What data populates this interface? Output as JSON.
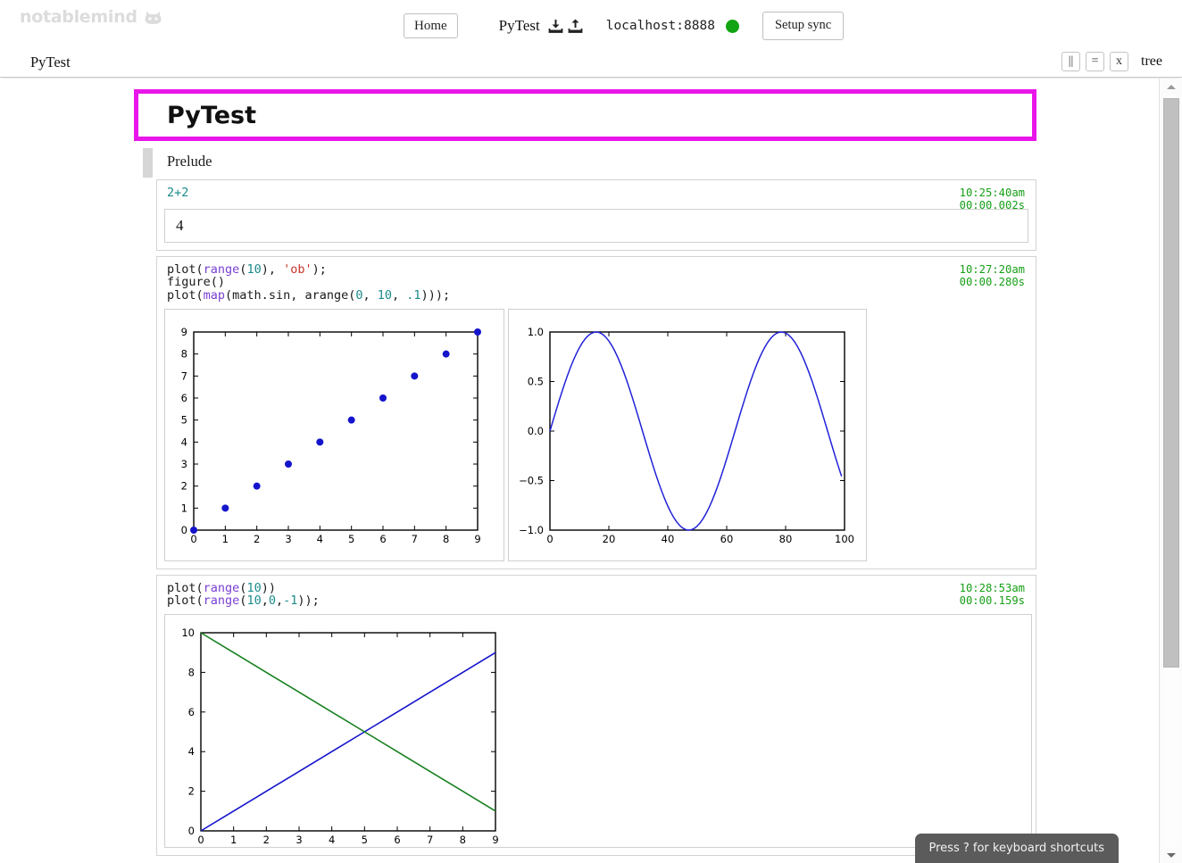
{
  "app": {
    "logo_text": "notablemind",
    "logo_icon": "cat-face-icon"
  },
  "header": {
    "home_label": "Home",
    "document_name": "PyTest",
    "download_icon": "download-icon",
    "upload_icon": "upload-icon",
    "hostname": "localhost:8888",
    "status": "connected",
    "status_color": "#13a413",
    "setup_sync_label": "Setup sync"
  },
  "breadcrumb": {
    "path": "PyTest",
    "tools": [
      {
        "name": "split-view-button",
        "label": "||"
      },
      {
        "name": "equals-button",
        "label": "="
      },
      {
        "name": "close-button",
        "label": "x"
      }
    ],
    "tree_label": "tree"
  },
  "document": {
    "title": "PyTest",
    "title_border_color": "#e916e9",
    "section_label": "Prelude"
  },
  "cells": [
    {
      "id": "cell-1",
      "code_lines": [
        [
          {
            "t": "2+2",
            "c": "exprline"
          }
        ]
      ],
      "timestamp": "10:25:40am",
      "duration": "00:00.002s",
      "result": "4",
      "figures": []
    },
    {
      "id": "cell-2",
      "code_lines": [
        [
          {
            "t": "plot",
            "c": "fn"
          },
          {
            "t": "(",
            "c": "punct"
          },
          {
            "t": "range",
            "c": "kw"
          },
          {
            "t": "(",
            "c": "punct"
          },
          {
            "t": "10",
            "c": "num"
          },
          {
            "t": "), ",
            "c": "punct"
          },
          {
            "t": "'ob'",
            "c": "str"
          },
          {
            "t": ");",
            "c": "punct"
          }
        ],
        [
          {
            "t": "figure",
            "c": "fn"
          },
          {
            "t": "()",
            "c": "punct"
          }
        ],
        [
          {
            "t": "plot",
            "c": "fn"
          },
          {
            "t": "(",
            "c": "punct"
          },
          {
            "t": "map",
            "c": "kw"
          },
          {
            "t": "(math.sin, arange(",
            "c": "punct"
          },
          {
            "t": "0",
            "c": "num"
          },
          {
            "t": ", ",
            "c": "punct"
          },
          {
            "t": "10",
            "c": "num"
          },
          {
            "t": ", ",
            "c": "punct"
          },
          {
            "t": ".1",
            "c": "num"
          },
          {
            "t": ")));",
            "c": "punct"
          }
        ]
      ],
      "timestamp": "10:27:20am",
      "duration": "00:00.280s",
      "result": null,
      "figures": [
        "figure-scatter",
        "figure-sine"
      ]
    },
    {
      "id": "cell-3",
      "code_lines": [
        [
          {
            "t": "plot",
            "c": "fn"
          },
          {
            "t": "(",
            "c": "punct"
          },
          {
            "t": "range",
            "c": "kw"
          },
          {
            "t": "(",
            "c": "punct"
          },
          {
            "t": "10",
            "c": "num"
          },
          {
            "t": "))",
            "c": "punct"
          }
        ],
        [
          {
            "t": "plot",
            "c": "fn"
          },
          {
            "t": "(",
            "c": "punct"
          },
          {
            "t": "range",
            "c": "kw"
          },
          {
            "t": "(",
            "c": "punct"
          },
          {
            "t": "10",
            "c": "num"
          },
          {
            "t": ",",
            "c": "punct"
          },
          {
            "t": "0",
            "c": "num"
          },
          {
            "t": ",",
            "c": "punct"
          },
          {
            "t": "-1",
            "c": "num"
          },
          {
            "t": "));",
            "c": "punct"
          }
        ]
      ],
      "timestamp": "10:28:53am",
      "duration": "00:00.159s",
      "result": null,
      "figures": [
        "figure-cross"
      ]
    }
  ],
  "chart_data": [
    {
      "id": "figure-scatter",
      "type": "scatter",
      "title": "",
      "xlabel": "",
      "ylabel": "",
      "xlim": [
        0,
        9
      ],
      "ylim": [
        0,
        9
      ],
      "xticks": [
        0,
        1,
        2,
        3,
        4,
        5,
        6,
        7,
        8,
        9
      ],
      "yticks": [
        0,
        1,
        2,
        3,
        4,
        5,
        6,
        7,
        8,
        9
      ],
      "grid": false,
      "legend": "none",
      "series": [
        {
          "name": "range(10)",
          "marker": "o",
          "color": "#1414cc",
          "x": [
            0,
            1,
            2,
            3,
            4,
            5,
            6,
            7,
            8,
            9
          ],
          "y": [
            0,
            1,
            2,
            3,
            4,
            5,
            6,
            7,
            8,
            9
          ]
        }
      ]
    },
    {
      "id": "figure-sine",
      "type": "line",
      "title": "",
      "xlabel": "",
      "ylabel": "",
      "xlim": [
        0,
        100
      ],
      "ylim": [
        -1.0,
        1.0
      ],
      "xticks": [
        0,
        20,
        40,
        60,
        80,
        100
      ],
      "yticks": [
        -1.0,
        -0.5,
        0.0,
        0.5,
        1.0
      ],
      "ytick_labels": [
        "−1.0",
        "−0.5",
        "0.0",
        "0.5",
        "1.0"
      ],
      "grid": false,
      "legend": "none",
      "series": [
        {
          "name": "sin(arange(0,10,.1))",
          "color": "#2222d8",
          "formula": "y = sin(x * 0.1), x = index 0..99"
        }
      ]
    },
    {
      "id": "figure-cross",
      "type": "line",
      "title": "",
      "xlabel": "",
      "ylabel": "",
      "xlim": [
        0,
        9
      ],
      "ylim": [
        0,
        10
      ],
      "xticks": [
        0,
        1,
        2,
        3,
        4,
        5,
        6,
        7,
        8,
        9
      ],
      "yticks": [
        0,
        2,
        4,
        6,
        8,
        10
      ],
      "grid": false,
      "legend": "none",
      "series": [
        {
          "name": "range(10)",
          "color": "#1414cc",
          "x": [
            0,
            1,
            2,
            3,
            4,
            5,
            6,
            7,
            8,
            9
          ],
          "y": [
            0,
            1,
            2,
            3,
            4,
            5,
            6,
            7,
            8,
            9
          ]
        },
        {
          "name": "range(10,0,-1)",
          "color": "#17801f",
          "x": [
            0,
            1,
            2,
            3,
            4,
            5,
            6,
            7,
            8,
            9
          ],
          "y": [
            10,
            9,
            8,
            7,
            6,
            5,
            4,
            3,
            2,
            1
          ]
        }
      ]
    }
  ],
  "footer": {
    "hint": "Press ? for keyboard shortcuts"
  }
}
